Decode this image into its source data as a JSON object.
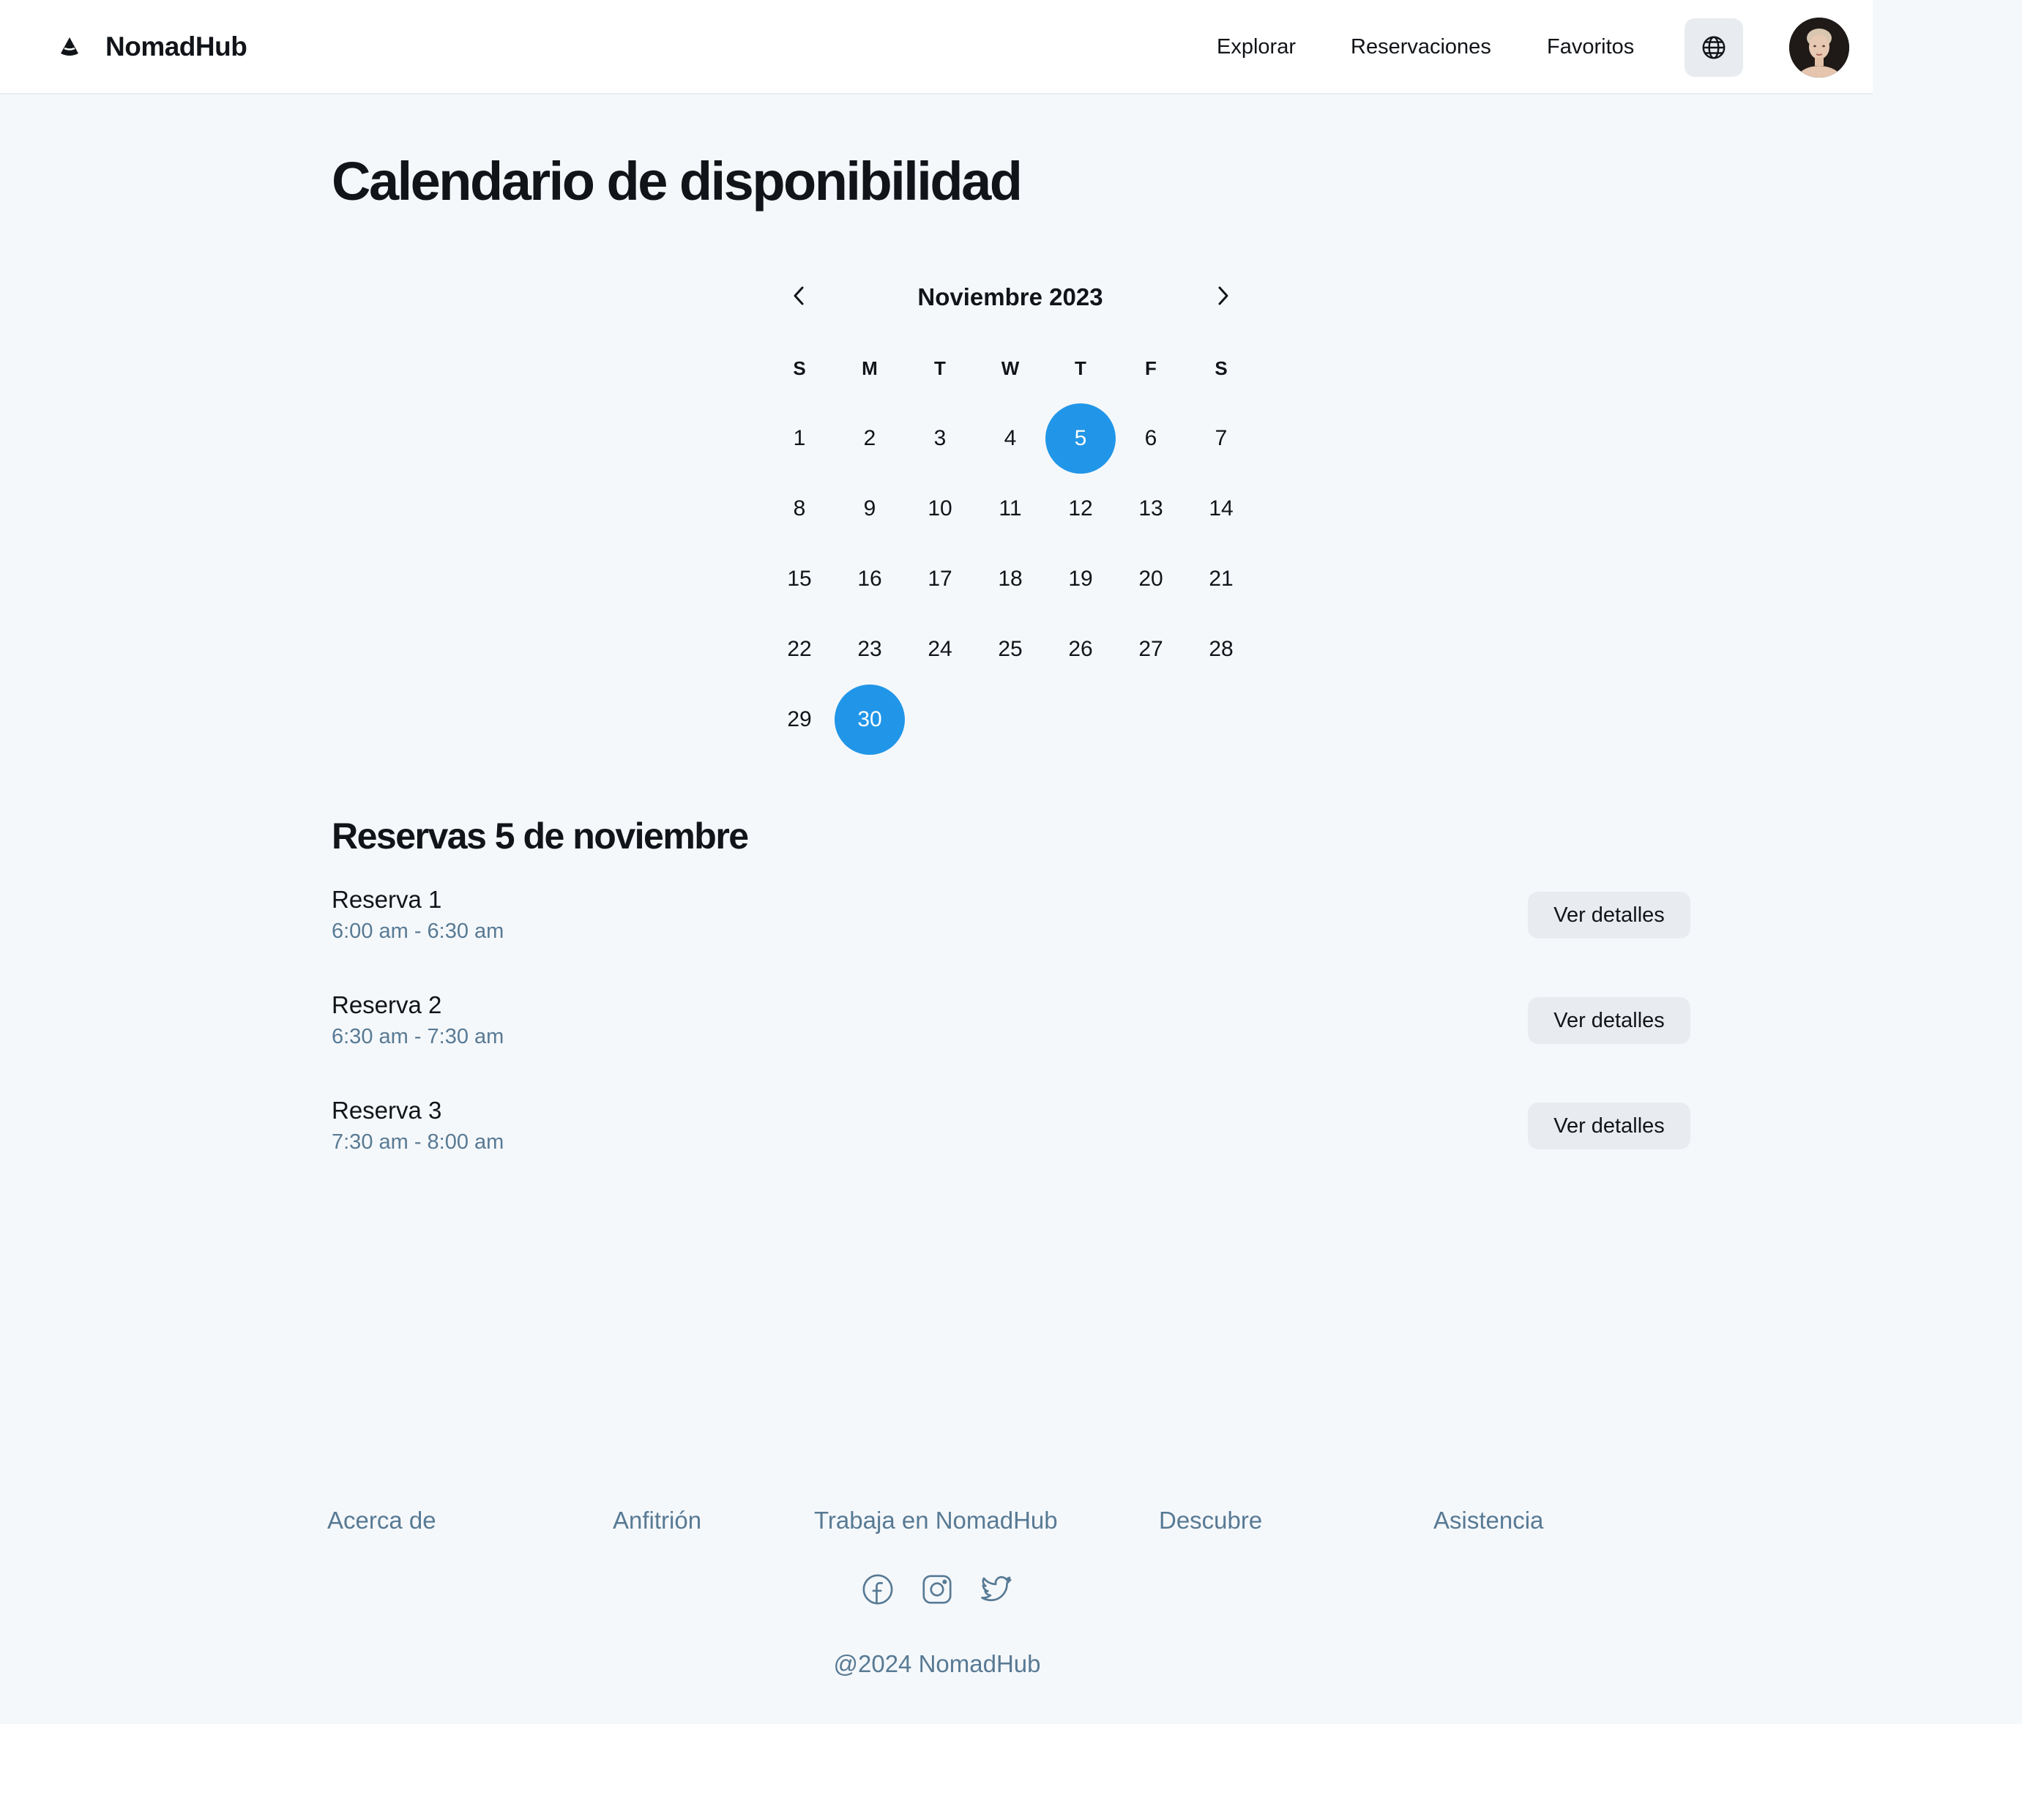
{
  "header": {
    "brand": "NomadHub",
    "nav": [
      "Explorar",
      "Reservaciones",
      "Favoritos"
    ]
  },
  "page": {
    "title": "Calendario de disponibilidad"
  },
  "calendar": {
    "month_label": "Noviembre 2023",
    "weekdays": [
      "S",
      "M",
      "T",
      "W",
      "T",
      "F",
      "S"
    ],
    "days": [
      "1",
      "2",
      "3",
      "4",
      "5",
      "6",
      "7",
      "8",
      "9",
      "10",
      "11",
      "12",
      "13",
      "14",
      "15",
      "16",
      "17",
      "18",
      "19",
      "20",
      "21",
      "22",
      "23",
      "24",
      "25",
      "26",
      "27",
      "28",
      "29",
      "30"
    ],
    "selected_days": [
      "5",
      "30"
    ],
    "accent_color": "#2196e8"
  },
  "reservations": {
    "title": "Reservas 5 de noviembre",
    "items": [
      {
        "name": "Reserva 1",
        "time": "6:00 am - 6:30 am",
        "button": "Ver detalles"
      },
      {
        "name": "Reserva 2",
        "time": "6:30 am - 7:30 am",
        "button": "Ver detalles"
      },
      {
        "name": "Reserva 3",
        "time": "7:30 am - 8:00 am",
        "button": "Ver detalles"
      }
    ]
  },
  "footer": {
    "links": [
      "Acerca de",
      "Anfitrión",
      "Trabaja en NomadHub",
      "Descubre",
      "Asistencia"
    ],
    "social": [
      "facebook-icon",
      "instagram-icon",
      "twitter-icon"
    ],
    "copyright": "@2024 NomadHub"
  }
}
